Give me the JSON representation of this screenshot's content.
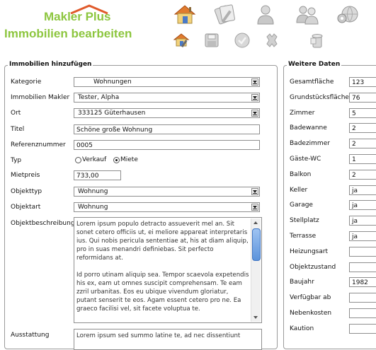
{
  "header": {
    "logo_text": "Makler Plus",
    "page_title": "Immobilien bearbeiten",
    "nav_icons": [
      "house-icon",
      "edit-document-icon",
      "user-icon",
      "users-icon",
      "settings-globe-icon"
    ],
    "toolbar_icons": [
      "house-edit-icon",
      "save-icon",
      "ok-icon",
      "delete-icon",
      "trash-icon"
    ]
  },
  "colors": {
    "brand_green": "#8dc63f",
    "roof_orange": "#e05a2b"
  },
  "add": {
    "legend": "Immobilien hinzufügen",
    "kategorie_label": "Kategorie",
    "kategorie_value": "Wohnungen",
    "makler_label": "Immobilien Makler",
    "makler_value": "Tester, Alpha",
    "ort_label": "Ort",
    "ort_value": "333125 Güterhausen",
    "titel_label": "Titel",
    "titel_value": "Schöne große Wohnung",
    "ref_label": "Referenznummer",
    "ref_value": "0005",
    "typ_label": "Typ",
    "typ_option1": "Verkauf",
    "typ_option2": "Miete",
    "typ_selected": "Miete",
    "mietpreis_label": "Mietpreis",
    "mietpreis_value": "733,00",
    "objekttyp_label": "Objekttyp",
    "objekttyp_value": "Wohnung",
    "objektart_label": "Objektart",
    "objektart_value": "Wohnung",
    "beschreibung_label": "Objektbeschreibung",
    "beschreibung_value": "Lorem ipsum populo detracto assueverit mel an. Sit sonet cetero officiis ut, ei meliore appareat interpretaris ius. Qui nobis pericula sententiae at, his at diam aliquip, pro in suas menandri definiebas. Sit perfecto reformidans at.\n\nId porro utinam aliquip sea. Tempor scaevola expetendis his ex, eam ut omnes suscipit comprehensam. Te eam zzril urbanitas. Eos eu ubique vivendum gloriatur, putant senserit te eos. Agam essent cetero pro ne. Ea graeco facilisi vel, sit facete voluptua te.",
    "ausstattung_label": "Ausstattung",
    "ausstattung_value": "Lorem ipsum sed summo latine te, ad nec dissentiunt"
  },
  "weitere": {
    "legend": "Weitere Daten",
    "fields": [
      {
        "label": "Gesamtfläche",
        "value": "123"
      },
      {
        "label": "Grundstücksfläche",
        "value": "76"
      },
      {
        "label": "Zimmer",
        "value": "5"
      },
      {
        "label": "Badewanne",
        "value": "2"
      },
      {
        "label": "Badezimmer",
        "value": "2"
      },
      {
        "label": "Gäste-WC",
        "value": "1"
      },
      {
        "label": "Balkon",
        "value": "2"
      },
      {
        "label": "Keller",
        "value": "ja"
      },
      {
        "label": "Garage",
        "value": "ja"
      },
      {
        "label": "Stellplatz",
        "value": "ja"
      },
      {
        "label": "Terrasse",
        "value": "ja"
      },
      {
        "label": "Heizungsart",
        "value": ""
      },
      {
        "label": "Objektzustand",
        "value": ""
      },
      {
        "label": "Baujahr",
        "value": "1982"
      },
      {
        "label": "Verfügbar ab",
        "value": ""
      },
      {
        "label": "Nebenkosten",
        "value": ""
      },
      {
        "label": "Kaution",
        "value": ""
      }
    ]
  }
}
